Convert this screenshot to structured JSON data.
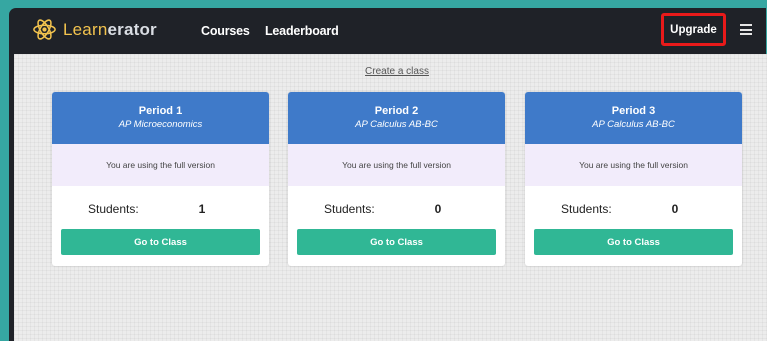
{
  "app": {
    "logo_text_prefix": "Learn",
    "logo_text_suffix": "erator",
    "brand_colors": {
      "gold": "#f2c34e",
      "teal": "#36a7a2",
      "card_blue": "#3f7ac9",
      "button_green": "#30b795",
      "highlight_red": "#e91a1a"
    }
  },
  "nav": {
    "courses": "Courses",
    "leaderboard": "Leaderboard",
    "upgrade": "Upgrade",
    "menu_icon": "hamburger-menu-icon"
  },
  "main": {
    "create_class": "Create a class",
    "classes": [
      {
        "period": "Period 1",
        "course": "AP Microeconomics",
        "status": "You are using the full version",
        "students_label": "Students:",
        "students_count": "1",
        "button": "Go to Class"
      },
      {
        "period": "Period 2",
        "course": "AP Calculus AB-BC",
        "status": "You are using the full version",
        "students_label": "Students:",
        "students_count": "0",
        "button": "Go to Class"
      },
      {
        "period": "Period 3",
        "course": "AP Calculus AB-BC",
        "status": "You are using the full version",
        "students_label": "Students:",
        "students_count": "0",
        "button": "Go to Class"
      }
    ]
  }
}
